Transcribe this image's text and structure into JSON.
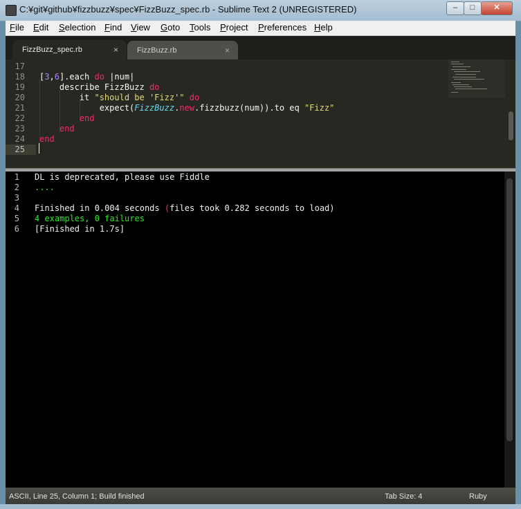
{
  "window": {
    "title": "C:¥git¥github¥fizzbuzz¥spec¥FizzBuzz_spec.rb - Sublime Text 2 (UNREGISTERED)",
    "minimize": "–",
    "maximize": "□",
    "close": "✕"
  },
  "menu": [
    "File",
    "Edit",
    "Selection",
    "Find",
    "View",
    "Goto",
    "Tools",
    "Project",
    "Preferences",
    "Help"
  ],
  "tabs": [
    {
      "label": "FizzBuzz_spec.rb",
      "close": "×",
      "active": true
    },
    {
      "label": "FizzBuzz.rb",
      "close": "×",
      "active": false
    }
  ],
  "editor": {
    "lines": [
      {
        "n": "17",
        "indent": "",
        "segments": []
      },
      {
        "n": "18",
        "indent": "",
        "segments": [
          [
            "p",
            "["
          ],
          [
            "num",
            "3"
          ],
          [
            "p",
            ","
          ],
          [
            "num",
            "6"
          ],
          [
            "p",
            "].each "
          ],
          [
            "kw",
            "do"
          ],
          [
            "p",
            " |num|"
          ]
        ]
      },
      {
        "n": "19",
        "indent": "    ",
        "segments": [
          [
            "p",
            "describe FizzBuzz "
          ],
          [
            "kw",
            "do"
          ]
        ]
      },
      {
        "n": "20",
        "indent": "        ",
        "segments": [
          [
            "p",
            "it "
          ],
          [
            "str",
            "\"should be 'Fizz'\""
          ],
          [
            "p",
            " "
          ],
          [
            "kw",
            "do"
          ]
        ]
      },
      {
        "n": "21",
        "indent": "            ",
        "segments": [
          [
            "p",
            "expect("
          ],
          [
            "cls",
            "FizzBuzz"
          ],
          [
            "p",
            "."
          ],
          [
            "kw",
            "new"
          ],
          [
            "p",
            ".fizzbuzz(num)).to eq "
          ],
          [
            "str",
            "\"Fizz\""
          ]
        ]
      },
      {
        "n": "22",
        "indent": "        ",
        "segments": [
          [
            "kw",
            "end"
          ]
        ]
      },
      {
        "n": "23",
        "indent": "    ",
        "segments": [
          [
            "kw",
            "end"
          ]
        ]
      },
      {
        "n": "24",
        "indent": "",
        "segments": [
          [
            "kw",
            "end"
          ]
        ]
      },
      {
        "n": "25",
        "indent": "",
        "segments": [],
        "current": true
      }
    ]
  },
  "output": {
    "lines": [
      {
        "n": "1",
        "segments": [
          [
            "w",
            "DL is deprecated, please use Fiddle"
          ]
        ]
      },
      {
        "n": "2",
        "segments": [
          [
            "g",
            "...."
          ]
        ]
      },
      {
        "n": "3",
        "segments": []
      },
      {
        "n": "4",
        "segments": [
          [
            "w",
            "Finished in 0.004 seconds "
          ],
          [
            "pk",
            "("
          ],
          [
            "w",
            "files took 0.282 seconds to load)"
          ]
        ]
      },
      {
        "n": "5",
        "segments": [
          [
            "g",
            "4 examples, 0 failures"
          ]
        ]
      },
      {
        "n": "6",
        "segments": [
          [
            "w",
            "[Finished in 1.7s]"
          ]
        ]
      }
    ]
  },
  "status": {
    "left": "ASCII, Line 25, Column 1; Build finished",
    "tab_size": "Tab Size: 4",
    "syntax": "Ruby"
  },
  "colors": {
    "editor_bg": "#272822",
    "keyword": "#f92672",
    "number": "#ae81ff",
    "string": "#e6db74",
    "class": "#66d9ef",
    "output_success": "#2ee22e"
  }
}
